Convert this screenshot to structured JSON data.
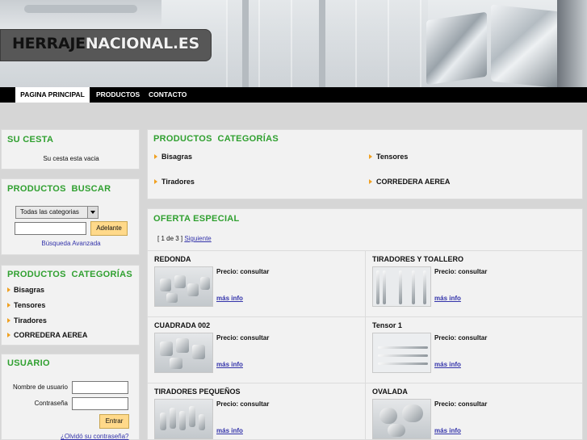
{
  "header": {
    "logo_dark": "HERRAJE",
    "logo_light": "NACIONAL.ES"
  },
  "nav": {
    "items": [
      "PAGINA PRINCIPAL",
      "PRODUCTOS",
      "CONTACTO"
    ],
    "active": "PAGINA PRINCIPAL"
  },
  "cart": {
    "title": "SU CESTA",
    "empty_text": "Su cesta esta vacia"
  },
  "search": {
    "title": "PRODUCTOS  BUSCAR",
    "category_selected": "Todas las categorias",
    "button_label": "Adelante",
    "advanced_link": "Búsqueda Avanzada"
  },
  "sidebar_categories": {
    "title": "PRODUCTOS  CATEGORÍAS",
    "items": [
      "Bisagras",
      "Tensores",
      "Tiradores",
      "CORREDERA AEREA"
    ]
  },
  "user": {
    "title": "USUARIO",
    "username_label": "Nombre de usuario",
    "password_label": "Contraseña",
    "login_button": "Entrar",
    "forgot_link": "¿Olvidó su contraseña?"
  },
  "main_categories": {
    "title": "PRODUCTOS  CATEGORÍAS",
    "items": [
      "Bisagras",
      "Tensores",
      "Tiradores",
      "CORREDERA AEREA"
    ]
  },
  "offer": {
    "title": "OFERTA ESPECIAL",
    "pager_text": "[ 1 de 3 ]",
    "pager_next": "Siguiente",
    "products": [
      {
        "name": "REDONDA",
        "price": "Precio: consultar",
        "more": "más info"
      },
      {
        "name": "TIRADORES Y TOALLERO",
        "price": "Precio: consultar",
        "more": "más info"
      },
      {
        "name": "CUADRADA 002",
        "price": "Precio: consultar",
        "more": "más info"
      },
      {
        "name": "Tensor 1",
        "price": "Precio: consultar",
        "more": "más info"
      },
      {
        "name": "TIRADORES PEQUEÑOS",
        "price": "Precio: consultar",
        "more": "más info"
      },
      {
        "name": "OVALADA",
        "price": "Precio: consultar",
        "more": "más info"
      }
    ]
  },
  "colors": {
    "title_green": "#30a030",
    "button_yellow": "#ffd98a",
    "link_blue": "#3333aa",
    "bullet_orange": "#f0a020"
  }
}
